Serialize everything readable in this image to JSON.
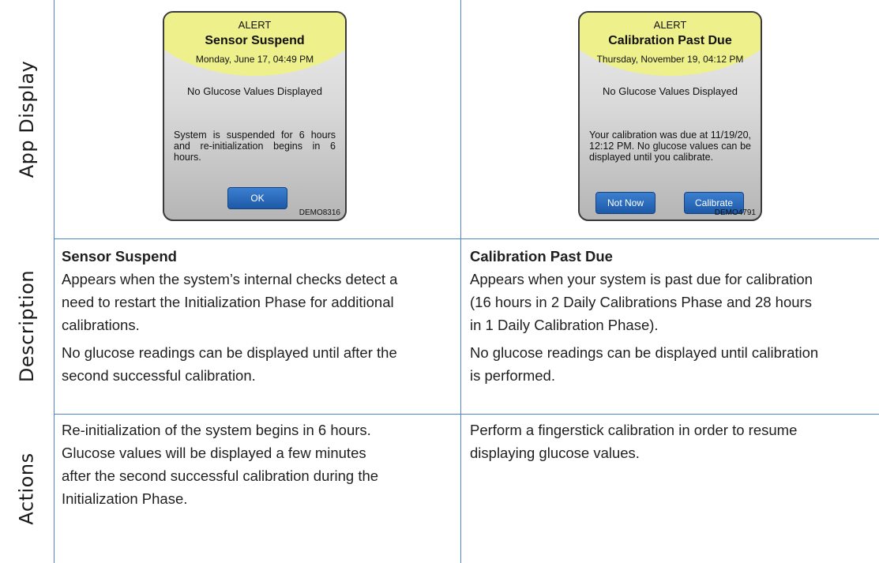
{
  "rows": {
    "app_display": "App Display",
    "description": "Description",
    "actions": "Actions"
  },
  "left": {
    "alert": {
      "label": "ALERT",
      "title": "Sensor Suspend",
      "date": "Monday, June 17, 04:49 PM",
      "no_glucose": "No Glucose Values Displayed",
      "body": "System is suspended for 6 hours and re-initialization begins in 6 hours.",
      "button": "OK",
      "id": "DEMO8316"
    },
    "description": {
      "heading": "Sensor Suspend",
      "lines": [
        "Appears when the system’s internal checks detect a",
        "need to restart the Initialization Phase for additional",
        "calibrations."
      ],
      "lines2": [
        "No glucose readings can be displayed until after the",
        "second successful calibration."
      ]
    },
    "actions": [
      "Re-initialization of the system begins in 6 hours.",
      "Glucose values will be displayed a few minutes",
      "after the second successful calibration during the",
      "Initialization Phase."
    ]
  },
  "right": {
    "alert": {
      "label": "ALERT",
      "title": "Calibration Past Due",
      "date": "Thursday, November 19, 04:12 PM",
      "no_glucose": "No Glucose Values Displayed",
      "body": "Your calibration was due at 11/19/20, 12:12 PM. No glucose values can be displayed until you calibrate.",
      "button_left": "Not Now",
      "button_right": "Calibrate",
      "id": "DEMO4791"
    },
    "description": {
      "heading": "Calibration Past Due",
      "lines": [
        "Appears when your system is past due for calibration",
        "(16 hours in 2 Daily Calibrations Phase and 28 hours",
        "in 1 Daily Calibration Phase)."
      ],
      "lines2": [
        "No glucose readings can be displayed until calibration",
        "is performed."
      ]
    },
    "actions": [
      "Perform a fingerstick calibration in order to resume",
      "displaying glucose values."
    ]
  }
}
